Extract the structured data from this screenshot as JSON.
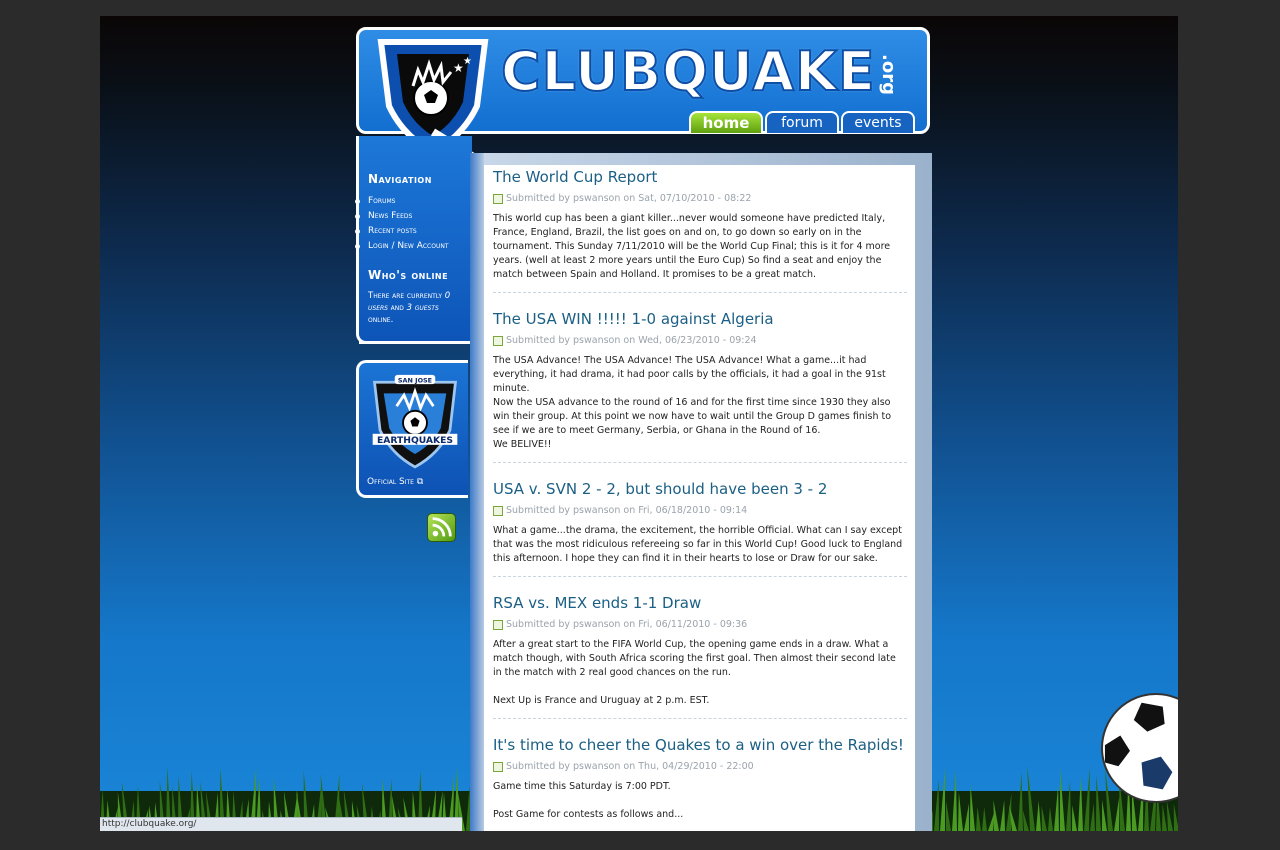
{
  "header": {
    "brand": "CLUBQUAKE",
    "brand_suffix": ".org",
    "tabs": [
      {
        "label": "home",
        "active": true
      },
      {
        "label": "forum",
        "active": false
      },
      {
        "label": "events",
        "active": false
      }
    ]
  },
  "sidebar": {
    "navigation_title": "Navigation",
    "nav_items": [
      "Forums",
      "News Feeds",
      "Recent posts",
      "Login / New Account"
    ],
    "online_title": "Who's online",
    "online_prefix": "There are currently ",
    "online_users": "0 users",
    "online_and": " and ",
    "online_guests": "3 guests",
    "online_suffix": " online.",
    "quakes_badge_top": "SAN JOSE",
    "quakes_badge_name": "EARTHQUAKES",
    "official_site": "Official Site"
  },
  "posts": [
    {
      "title": "The World Cup Report",
      "meta": "Submitted by pswanson on Sat, 07/10/2010 - 08:22",
      "body": [
        "This world cup has been a giant killer...never would someone have predicted Italy, France, England, Brazil, the list goes on and on, to go down so early on in the tournament. This Sunday 7/11/2010 will be the World Cup Final; this is it for 4 more years. (well at least 2 more years until the Euro Cup) So find a seat and enjoy the match between Spain and Holland. It promises to be a great match."
      ]
    },
    {
      "title": "The USA WIN !!!!! 1-0 against Algeria",
      "meta": "Submitted by pswanson on Wed, 06/23/2010 - 09:24",
      "body": [
        "The USA Advance! The USA Advance! The USA Advance! What a game...it had everything, it had drama, it had poor calls by the officials, it had a goal in the 91st minute.",
        "Now the USA advance to the round of 16 and for the first time since 1930 they also win their group. At this point we now have to wait until the Group D games finish to see if we are to meet Germany, Serbia, or Ghana in the Round of 16.",
        "We BELIVE!!"
      ]
    },
    {
      "title": "USA v. SVN 2 - 2, but should have been 3 - 2",
      "meta": "Submitted by pswanson on Fri, 06/18/2010 - 09:14",
      "body": [
        "What a game...the drama, the excitement, the horrible Official. What can I say except that was the most ridiculous refereeing so far in this World Cup! Good luck to England this afternoon. I hope they can find it in their hearts to lose or Draw for our sake."
      ]
    },
    {
      "title": "RSA vs. MEX ends 1-1 Draw",
      "meta": "Submitted by pswanson on Fri, 06/11/2010 - 09:36",
      "body": [
        "After a great start to the FIFA World Cup, the opening game ends in a draw. What a match though, with South Africa scoring the first goal. Then almost their second late in the match with 2 real good chances on the run.",
        " ",
        "Next Up is France and Uruguay at 2 p.m. EST."
      ]
    },
    {
      "title": "It's time to cheer the Quakes to a win over the Rapids!",
      "meta": "Submitted by pswanson on Thu, 04/29/2010 - 22:00",
      "body": [
        "Game time this Saturday is 7:00 PDT.",
        " ",
        "Post Game for contests as follows and..."
      ]
    }
  ],
  "status_url": "http://clubquake.org/",
  "colors": {
    "accent_blue": "#126fd0",
    "active_tab": "#7cc219",
    "title_link": "#1b5f85"
  }
}
